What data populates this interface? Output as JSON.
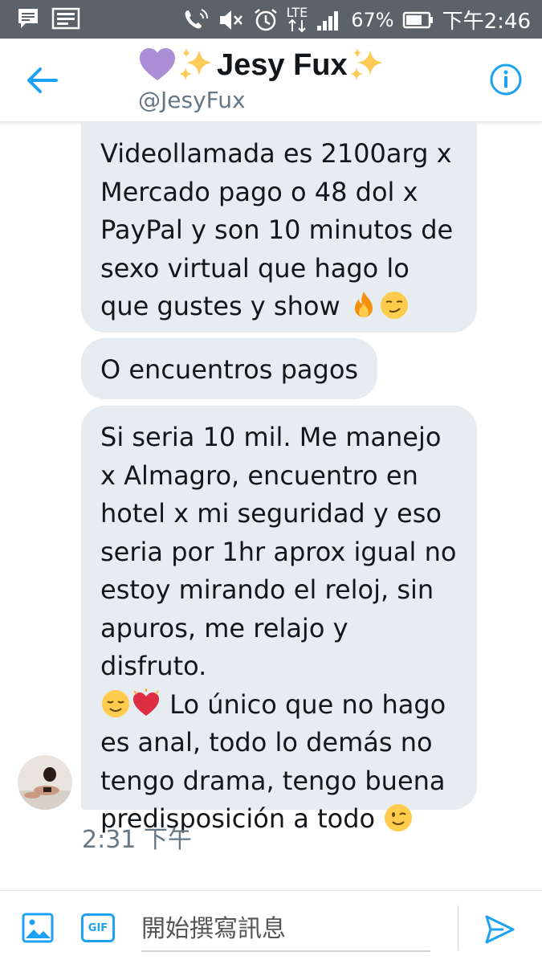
{
  "status_bar": {
    "lte": "LTE",
    "battery": "67%",
    "time": "下午2:46"
  },
  "header": {
    "title_name": "Jesy Fux",
    "handle": "@JesyFux",
    "icons": [
      "back-arrow-icon",
      "purple-heart-icon",
      "sparkles-icon",
      "info-icon"
    ]
  },
  "messages": [
    {
      "lines": [
        "Videollamada es 2100arg x",
        "Mercado pago o 48 dol x",
        "PayPal y son 10 minutos de",
        "sexo virtual que hago lo",
        "que gustes y show"
      ]
    },
    {
      "lines": [
        "O encuentros pagos"
      ]
    },
    {
      "lines": [
        "Si seria 10 mil. Me manejo",
        "x Almagro, encuentro en",
        "hotel x mi seguridad y eso",
        "seria por 1hr aprox igual no",
        "estoy mirando el reloj, sin",
        "apuros, me relajo y disfruto.",
        "Lo único que no hago",
        "es anal, todo lo demás no",
        "tengo drama, tengo buena",
        "predisposición a todo"
      ]
    }
  ],
  "timestamp": "2:31 下午",
  "composer": {
    "placeholder": "開始撰寫訊息",
    "gif_label": "GIF"
  },
  "colors": {
    "accent": "#1da1f2",
    "bubble": "#e6ecf0",
    "status_bar": "#5b6269"
  }
}
